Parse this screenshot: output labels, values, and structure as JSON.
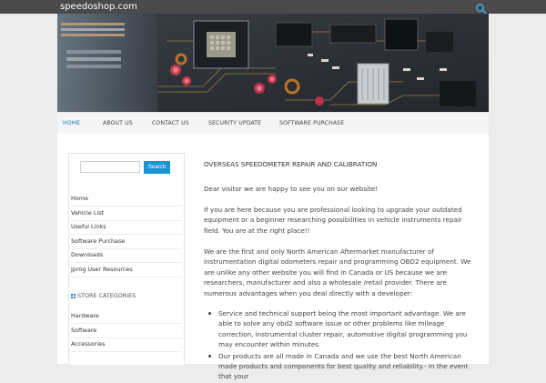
{
  "site": {
    "title": "speedoshop.com"
  },
  "nav": {
    "items": [
      {
        "label": "HOME",
        "active": true
      },
      {
        "label": "ABOUT US"
      },
      {
        "label": "CONTACT US"
      },
      {
        "label": "SECURITY UPDATE"
      },
      {
        "label": "SOFTWARE PURCHASE"
      }
    ]
  },
  "sidebar": {
    "search": {
      "placeholder": "",
      "value": "",
      "button_label": "Search"
    },
    "links": [
      "Home",
      "Vehicle List",
      "Useful Links",
      "Software Purchase",
      "Downloads",
      "Jprog User Resources"
    ],
    "store_heading": "STORE CATEGORIES",
    "categories": [
      "Hardware",
      "Software",
      "Accessories"
    ]
  },
  "main": {
    "heading": "OVERSEAS SPEEDOMETER REPAIR AND CALIBRATION",
    "paragraphs": [
      "Dear visitor we are happy to see you on our website!",
      "If you are here because you are professional looking to upgrade your outdated equipment or a beginner researching possibilities in vehicle instruments repair field. You are at the right place!!",
      "We are the first and only North American Aftermarket manufacturer of instrumentation digital odometers repair and programming OBD2 equipment. We are unlike any other website you will find in Canada or US because we are researchers, manufacturer and also a wholesale /retail provider. There are numerous advantages when you deal directly with a developer:"
    ],
    "bullets": [
      "Service and technical support being the most important advantage. We are able to solve any obd2 software issue or other problems like mileage correction, instrumental cluster repair, automotive digital programming you may encounter within minutes.",
      "Our products are all made in Canada and we use the best North American made products and components for best quality and reliability.- In the event that your"
    ]
  },
  "colors": {
    "accent": "#1a95d0",
    "topbar": "#4a4a4a",
    "nav_active": "#1c7cb8"
  }
}
